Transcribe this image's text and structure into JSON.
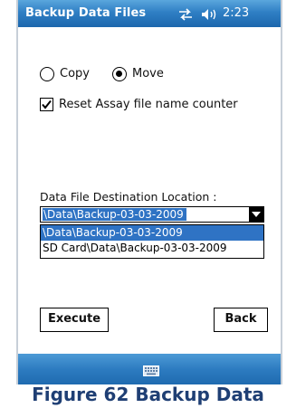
{
  "window": {
    "title": "Backup Data Files",
    "clock": "2:23"
  },
  "mode": {
    "options": [
      {
        "label": "Copy",
        "selected": false
      },
      {
        "label": "Move",
        "selected": true
      }
    ]
  },
  "reset_counter": {
    "label": "Reset Assay file name counter",
    "checked": true
  },
  "destination": {
    "label": "Data File Destination Location :",
    "selected_value": "\\Data\\Backup-03-03-2009",
    "options": [
      "\\Data\\Backup-03-03-2009",
      "SD Card\\Data\\Backup-03-03-2009"
    ]
  },
  "buttons": {
    "execute": "Execute",
    "back": "Back"
  },
  "icons": {
    "connectivity": "connectivity-icon",
    "volume": "volume-icon",
    "keyboard": "keyboard-icon"
  },
  "colors": {
    "titlebar": "#2f7fc4",
    "selection": "#2f73c4",
    "caption": "#1f3f74"
  },
  "caption": "Figure 62  Backup Data"
}
